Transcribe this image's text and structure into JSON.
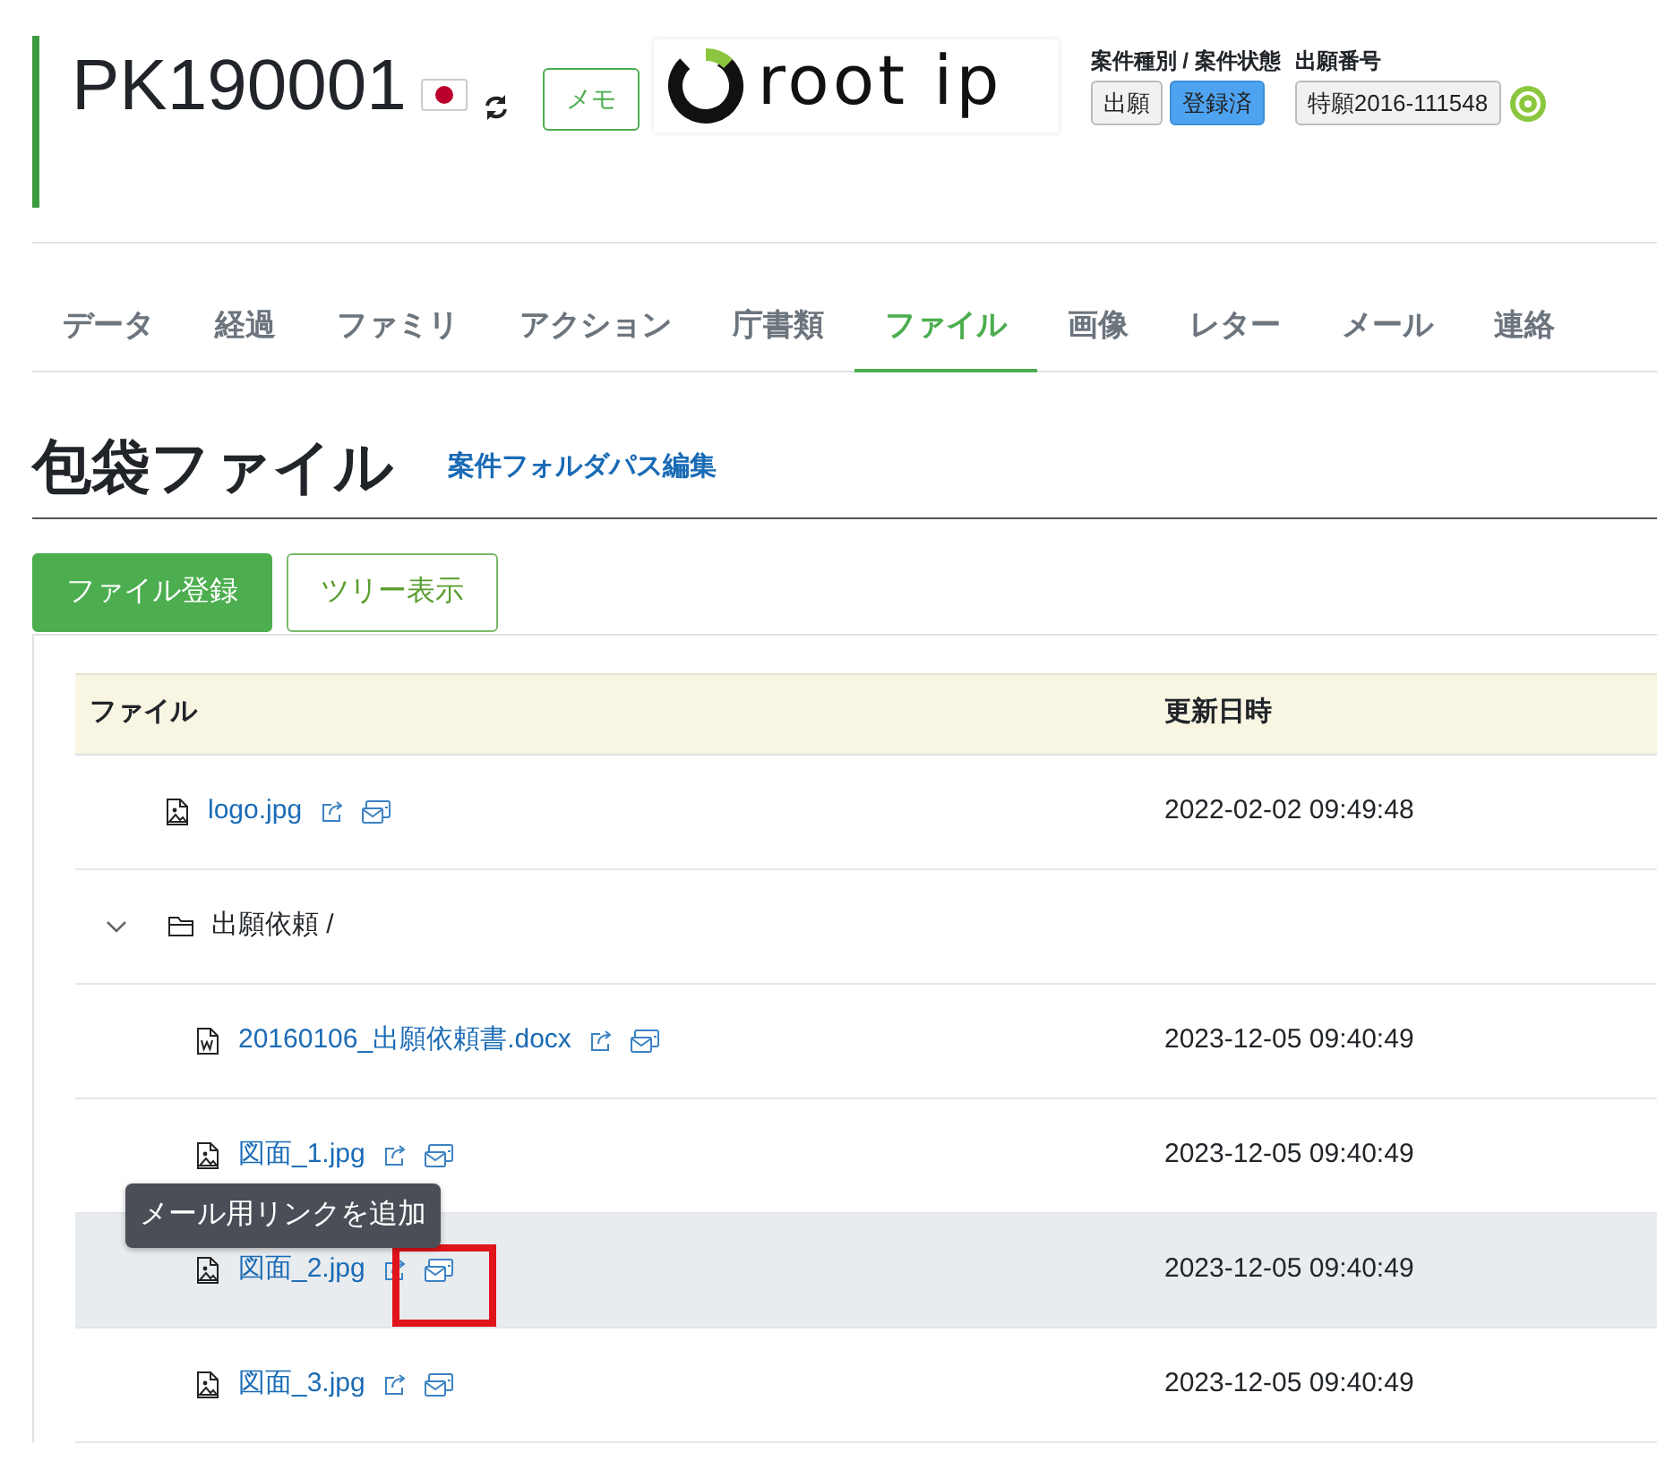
{
  "header": {
    "case_number": "PK190001",
    "memo_button": "メモ",
    "logo_text": "root ip",
    "type_status_label": "案件種別 / 案件状態",
    "statuses": [
      {
        "label": "出願",
        "selected": false
      },
      {
        "label": "登録済",
        "selected": true
      }
    ],
    "application_label": "出願番号",
    "application_number": "特願2016-111548"
  },
  "tabs": [
    {
      "label": "データ",
      "selected": false
    },
    {
      "label": "経過",
      "selected": false
    },
    {
      "label": "ファミリ",
      "selected": false
    },
    {
      "label": "アクション",
      "selected": false
    },
    {
      "label": "庁書類",
      "selected": false
    },
    {
      "label": "ファイル",
      "selected": true
    },
    {
      "label": "画像",
      "selected": false
    },
    {
      "label": "レター",
      "selected": false
    },
    {
      "label": "メール",
      "selected": false
    },
    {
      "label": "連絡",
      "selected": false
    }
  ],
  "section": {
    "title": "包袋ファイル",
    "edit_link": "案件フォルダパス編集"
  },
  "buttons": [
    {
      "label": "ファイル登録",
      "kind": "primary"
    },
    {
      "label": "ツリー表示",
      "kind": "outline"
    }
  ],
  "table": {
    "columns": [
      "ファイル",
      "更新日時"
    ],
    "rows": [
      {
        "kind": "image",
        "name": "logo.jpg",
        "updated": "2022-02-02 09:49:48",
        "highlighted": false
      },
      {
        "kind": "folder",
        "name": "出願依頼 /",
        "expanded": true,
        "highlighted": false,
        "children": [
          {
            "kind": "document",
            "name": "20160106_出願依頼書.docx",
            "updated": "2023-12-05 09:40:49",
            "highlighted": false
          },
          {
            "kind": "image",
            "name": "図面_1.jpg",
            "updated": "2023-12-05 09:40:49",
            "highlighted": false
          },
          {
            "kind": "image",
            "name": "図面_2.jpg",
            "updated": "2023-12-05 09:40:49",
            "highlighted": true,
            "tooltip": "メール用リンクを追加"
          },
          {
            "kind": "image",
            "name": "図面_3.jpg",
            "updated": "2023-12-05 09:40:49",
            "highlighted": false
          }
        ]
      }
    ]
  }
}
